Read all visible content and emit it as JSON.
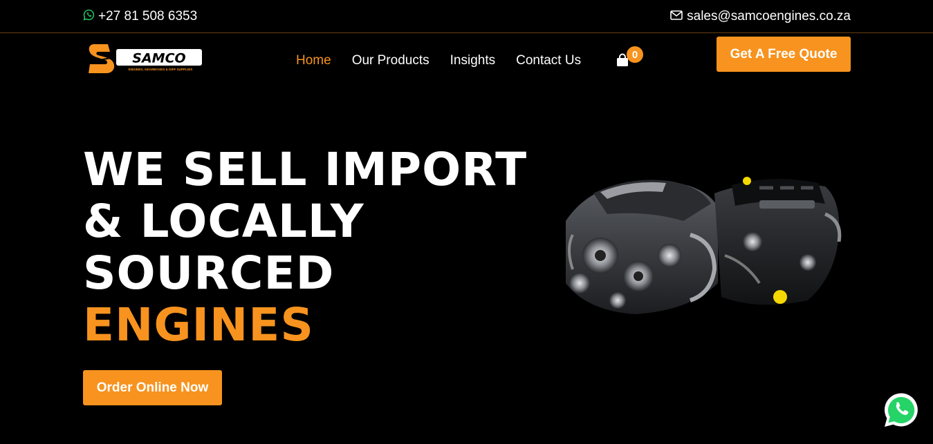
{
  "topbar": {
    "phone": "+27 81 508 6353",
    "phone_icon": "whatsapp-icon",
    "email": "sales@samcoengines.co.za",
    "email_icon": "envelope-icon"
  },
  "brand": {
    "name": "SAMCO",
    "tagline": "ENGINES, GEARBOXES & DIFF SUPPLIES"
  },
  "nav": {
    "items": [
      {
        "label": "Home",
        "active": true
      },
      {
        "label": "Our Products",
        "active": false
      },
      {
        "label": "Insights",
        "active": false
      },
      {
        "label": "Contact Us",
        "active": false
      }
    ],
    "cart_count": "0",
    "cart_icon": "shopping-bag-icon",
    "quote_label": "Get A Free Quote"
  },
  "hero": {
    "line1": "WE SELL IMPORT",
    "line2": "& LOCALLY",
    "line3": "SOURCED",
    "accent": "ENGINES",
    "cta_label": "Order Online Now",
    "image": "engines-image"
  },
  "floating": {
    "icon": "whatsapp-icon"
  },
  "colors": {
    "accent": "#f7931e",
    "background": "#000000",
    "whatsapp": "#25d366"
  }
}
